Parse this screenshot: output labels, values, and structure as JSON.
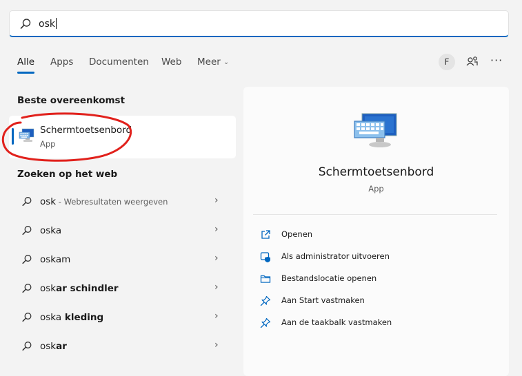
{
  "search": {
    "query": "osk"
  },
  "tabs": [
    {
      "label": "Alle",
      "active": true
    },
    {
      "label": "Apps"
    },
    {
      "label": "Documenten"
    },
    {
      "label": "Web"
    },
    {
      "label": "Meer"
    }
  ],
  "header_actions": {
    "avatar_letter": "F",
    "profile_icon": "people-switch-icon",
    "more_label": "···"
  },
  "best_match": {
    "heading": "Beste overeenkomst",
    "name": "Schermtoetsenbord",
    "type": "App",
    "annotation_color": "#e1211c"
  },
  "web_section": {
    "heading": "Zoeken op het web",
    "results": [
      {
        "typed": "osk",
        "rest": "",
        "sub": " - Webresultaten weergeven"
      },
      {
        "typed": "oska",
        "rest": "",
        "sub": ""
      },
      {
        "typed": "oskam",
        "rest": "",
        "sub": ""
      },
      {
        "typed": "osk",
        "rest": "ar schindler",
        "sub": ""
      },
      {
        "typed": "oska",
        "rest": " kleding",
        "sub": ""
      },
      {
        "typed": "osk",
        "rest": "ar",
        "sub": ""
      }
    ]
  },
  "detail": {
    "title": "Schermtoetsenbord",
    "subtitle": "App",
    "actions": [
      {
        "label": "Openen",
        "icon": "open-external-icon"
      },
      {
        "label": "Als administrator uitvoeren",
        "icon": "admin-shield-icon"
      },
      {
        "label": "Bestandslocatie openen",
        "icon": "folder-icon"
      },
      {
        "label": "Aan Start vastmaken",
        "icon": "pin-icon"
      },
      {
        "label": "Aan de taakbalk vastmaken",
        "icon": "pin-icon"
      }
    ]
  },
  "colors": {
    "accent": "#0067c0",
    "background": "#f3f3f3",
    "card": "#ffffff"
  }
}
